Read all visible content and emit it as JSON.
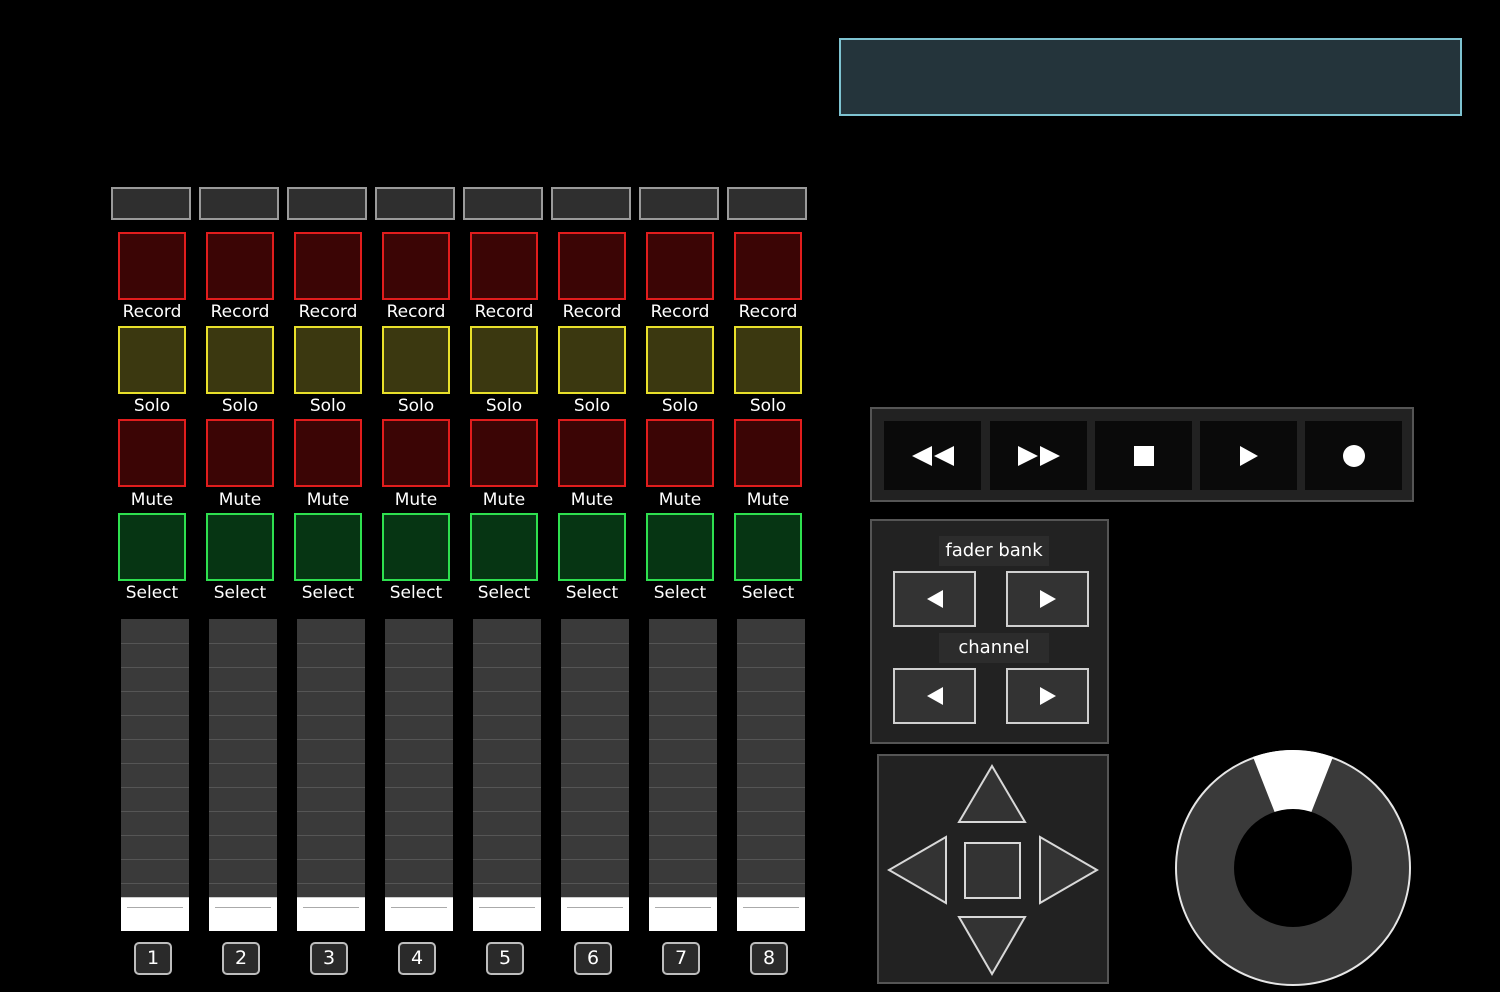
{
  "display": {
    "text": ""
  },
  "strips": [
    {
      "number": "1",
      "name": "",
      "record_label": "Record",
      "solo_label": "Solo",
      "mute_label": "Mute",
      "select_label": "Select",
      "fader_level": 0
    },
    {
      "number": "2",
      "name": "",
      "record_label": "Record",
      "solo_label": "Solo",
      "mute_label": "Mute",
      "select_label": "Select",
      "fader_level": 0
    },
    {
      "number": "3",
      "name": "",
      "record_label": "Record",
      "solo_label": "Solo",
      "mute_label": "Mute",
      "select_label": "Select",
      "fader_level": 0
    },
    {
      "number": "4",
      "name": "",
      "record_label": "Record",
      "solo_label": "Solo",
      "mute_label": "Mute",
      "select_label": "Select",
      "fader_level": 0
    },
    {
      "number": "5",
      "name": "",
      "record_label": "Record",
      "solo_label": "Solo",
      "mute_label": "Mute",
      "select_label": "Select",
      "fader_level": 0
    },
    {
      "number": "6",
      "name": "",
      "record_label": "Record",
      "solo_label": "Solo",
      "mute_label": "Mute",
      "select_label": "Select",
      "fader_level": 0
    },
    {
      "number": "7",
      "name": "",
      "record_label": "Record",
      "solo_label": "Solo",
      "mute_label": "Mute",
      "select_label": "Select",
      "fader_level": 0
    },
    {
      "number": "8",
      "name": "",
      "record_label": "Record",
      "solo_label": "Solo",
      "mute_label": "Mute",
      "select_label": "Select",
      "fader_level": 0
    }
  ],
  "transport": {
    "buttons": [
      "rewind-icon",
      "fast-forward-icon",
      "stop-icon",
      "play-icon",
      "record-icon"
    ]
  },
  "bank": {
    "fader_bank_label": "fader bank",
    "channel_label": "channel"
  },
  "colors": {
    "record": "#e11d1d",
    "solo": "#e8e02a",
    "mute": "#e11d1d",
    "select": "#2ee04f",
    "display_border": "#7ec3d1"
  }
}
